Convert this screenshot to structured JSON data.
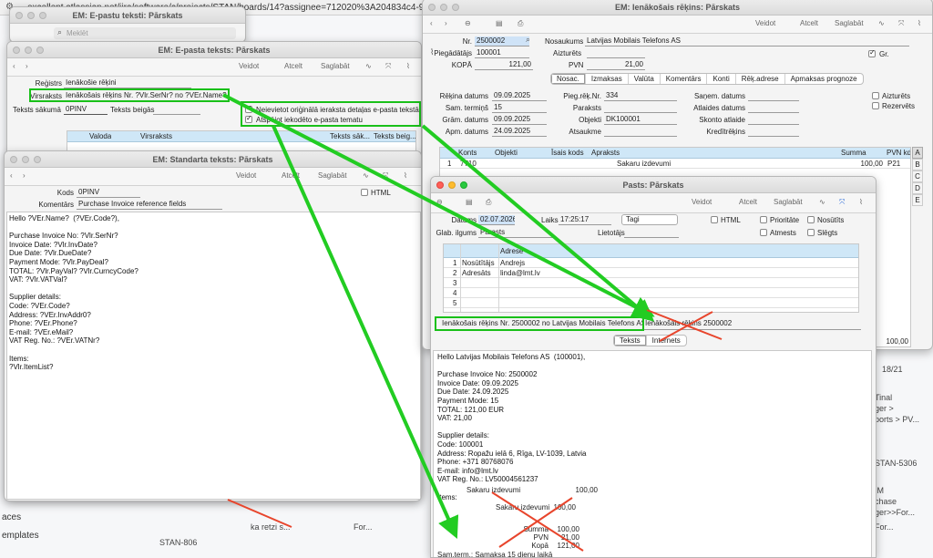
{
  "browser": {
    "url": "excellent.atlassian.net/jira/software/c/projects/STAN/boards/14?assignee=712020%3A204834c4-9c"
  },
  "background": {
    "sidebar_left": [
      "aces",
      "emplates"
    ],
    "items": [
      "STAN-806",
      "ka retzi s...",
      "For...",
      "STAN-5306",
      "For...",
      "Tinal",
      "ger >",
      "ports > PV...",
      "IM",
      "chase",
      "ger>>For...",
      "18/21"
    ]
  },
  "win_search": {
    "title": "EM: E-pastu teksti: Pārskats",
    "search": "Meklēt"
  },
  "win_email": {
    "title": "EM: E-pasta teksts: Pārskats",
    "toolbar": {
      "view": "Veidot",
      "cancel": "Atcelt",
      "save": "Saglabāt"
    },
    "reg_label": "Reģistrs",
    "reg_value": "Ienākošie rēķini",
    "subj_label": "Virsraksts",
    "subj_value": "Ienākošais rēķins Nr. ?Vlr.SerNr? no ?VEr.Name?",
    "start_label": "Teksts sākumā",
    "start_value": "0PINV",
    "end_label": "Teksts beigās",
    "cb1": "Neievietot oriģinālā ieraksta detaļas e-pasta tekstā",
    "cb2": "Atspējot iekodēto e-pasta tematu",
    "grid_headers": [
      "Valoda",
      "Virsraksts",
      "Teksts sāk...",
      "Teksts beig..."
    ]
  },
  "win_std": {
    "title": "EM: Standarta teksts: Pārskats",
    "toolbar": {
      "view": "Veidot",
      "cancel": "Atcelt",
      "save": "Saglabāt"
    },
    "code_label": "Kods",
    "code_value": "0PINV",
    "html_label": "HTML",
    "comment_label": "Komentārs",
    "comment_value": "Purchase Invoice reference fields",
    "body": "Hello ?VEr.Name?  (?VEr.Code?),\n\nPurchase Invoice No: ?Vlr.SerNr?\nInvoice Date: ?Vlr.InvDate?\nDue Date: ?Vlr.DueDate?\nPayment Mode: ?Vlr.PayDeal?\nTOTAL: ?Vlr.PayVal? ?Vlr.CurncyCode?\nVAT: ?Vlr.VATVal?\n\nSupplier details:\nCode: ?VEr.Code?\nAddress: ?VEr.InvAddr0?\nPhone: ?VEr.Phone?\nE-mail: ?VEr.eMail?\nVAT Reg. No.: ?VEr.VATNr?\n\nItems:\n?Vlr.ItemList?"
  },
  "win_inv": {
    "title": "EM: Ienākošais rēķins: Pārskats",
    "toolbar": {
      "view": "Veidot",
      "cancel": "Atcelt",
      "save": "Saglabāt"
    },
    "nr_label": "Nr.",
    "nr_value": "2500002",
    "name_label": "Nosaukums",
    "name_value": "Latvijas Mobilais Telefons AS",
    "supp_label": "Piegādātājs",
    "supp_value": "100001",
    "frozen_label": "Aizturēts",
    "total_label": "KOPĀ",
    "total_value": "121,00",
    "pvn_label": "PVN",
    "pvn_value": "21,00",
    "gr_label": "Gr.",
    "tabs": [
      "Nosac.",
      "Izmaksas",
      "Valūta",
      "Komentārs",
      "Konti",
      "Rēķ.adrese",
      "Apmaksas prognoze"
    ],
    "f": [
      [
        "Rēķina datums",
        "09.09.2025"
      ],
      [
        "Sam. termiņš",
        "15"
      ],
      [
        "Grām. datums",
        "09.09.2025"
      ],
      [
        "Apm. datums",
        "24.09.2025"
      ]
    ],
    "f2": [
      [
        "Pieg.rēķ.Nr.",
        "334"
      ],
      [
        "Paraksts",
        ""
      ],
      [
        "Objekti",
        "DK100001"
      ],
      [
        "Atsaukme",
        ""
      ]
    ],
    "f3": [
      "Saņem. datums",
      "Atlaides datums",
      "Skonto atlaide",
      "Kredītrēķins"
    ],
    "right_checks": [
      "Aizturēts",
      "Rezervēts"
    ],
    "grid_headers": [
      "Konts",
      "Objekti",
      "Īsais kods",
      "Apraksts",
      "Summa",
      "PVN kd"
    ],
    "row": {
      "n": "1",
      "acc": "7710",
      "desc": "Sakaru izdevumi",
      "sum": "100,00",
      "vat": "P21"
    },
    "letters": [
      "A",
      "B",
      "C",
      "D",
      "E"
    ],
    "total_bottom": "100,00"
  },
  "win_mail": {
    "title": "Pasts: Pārskats",
    "toolbar": {
      "view": "Veidot",
      "cancel": "Atcelt",
      "save": "Saglabāt"
    },
    "date_label": "Datums",
    "date_value": "02.07.2026",
    "time_label": "Laiks",
    "time_value": "17:25:17",
    "when": "Tagi",
    "html": "HTML",
    "prio": "Prioritāte",
    "sent": "Nosūtīts",
    "refused": "Atmests",
    "closed": "Slēgts",
    "store_label": "Glab. ilgums",
    "store_value": "Parasts",
    "user_label": "Lietotājs",
    "addr_header": "Adrese",
    "addr_rows": [
      [
        "1",
        "Nosūtītājs",
        "Andrejs"
      ],
      [
        "2",
        "Adresāts",
        "linda@lmt.lv"
      ],
      [
        "3",
        "",
        ""
      ],
      [
        "4",
        "",
        ""
      ],
      [
        "5",
        "",
        ""
      ]
    ],
    "subject": "Ienākošais rēķins Nr. 2500002 no Latvijas Mobilais Telefons AS",
    "subject_extra": "Ienākošais rēķins 2500002",
    "tabs": [
      "Teksts",
      "Internets"
    ],
    "body": "Hello Latvijas Mobilais Telefons AS  (100001),\n\nPurchase Invoice No: 2500002\nInvoice Date: 09.09.2025\nDue Date: 24.09.2025\nPayment Mode: 15\nTOTAL: 121,00 EUR\nVAT: 21,00\n\nSupplier details:\nCode: 100001\nAddress: Ropažu ielā 6, Rīga, LV-1039, Latvia\nPhone: +371 80768076\nE-mail: info@lmt.lv\nVAT Reg. No.: LV50004561237\n\nItems:",
    "items": [
      [
        "Sakaru izdevumi",
        "100,00"
      ],
      [
        "Sakaru izdevumi",
        "100,00"
      ]
    ],
    "summ": [
      [
        "Summa",
        "100,00"
      ],
      [
        "PVN",
        "21,00"
      ],
      [
        "Kopā",
        "121,00"
      ]
    ],
    "samterm": "Sam.term.: Samaksa 15 dienu laikā"
  }
}
